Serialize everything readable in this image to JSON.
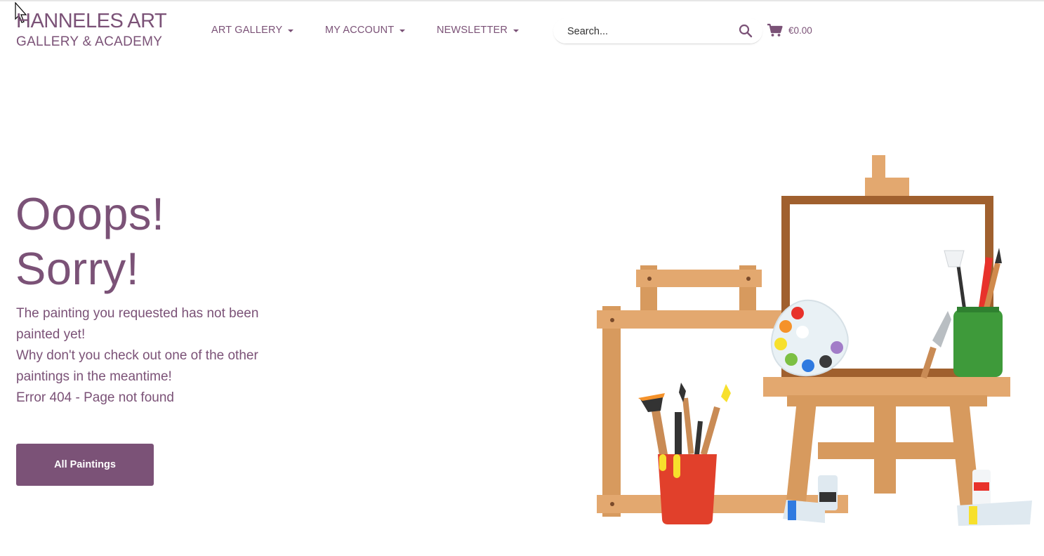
{
  "header": {
    "logo_line1": "HANNELES ART",
    "logo_line2": "GALLERY & ACADEMY",
    "nav": [
      {
        "label": "ART GALLERY"
      },
      {
        "label": "MY ACCOUNT"
      },
      {
        "label": "NEWSLETTER"
      }
    ],
    "search": {
      "placeholder": "Search...",
      "value": ""
    },
    "cart": {
      "amount": "€0.00"
    }
  },
  "hero": {
    "headline_line1": "Ooops!",
    "headline_line2": "Sorry!",
    "message_lines": [
      "The painting you requested has not been painted yet!",
      "Why don't you check out one of the other paintings in the meantime!",
      "Error 404 - Page not found"
    ],
    "button_label": "All Paintings"
  },
  "colors": {
    "brand": "#7b5277",
    "wood_light": "#e3a86f",
    "wood_dark": "#a0522d",
    "cup_red": "#e1402b",
    "jar_green": "#3e9a3a"
  }
}
